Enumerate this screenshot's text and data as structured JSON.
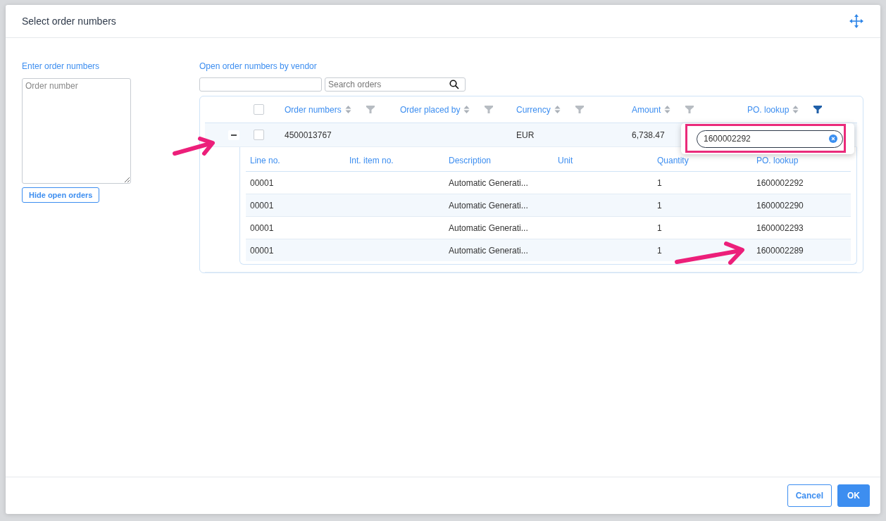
{
  "dialog": {
    "title": "Select order numbers",
    "left": {
      "heading": "Enter order numbers",
      "textarea": {
        "placeholder": "Order number"
      },
      "button": "Hide open orders"
    },
    "right": {
      "heading": "Open order numbers by vendor",
      "search": {
        "placeholder": "Search orders"
      },
      "table": {
        "header_checked": false,
        "columns": [
          {
            "label": "Order numbers",
            "filter_active": false
          },
          {
            "label": "Order placed by",
            "filter_active": false
          },
          {
            "label": "Currency",
            "filter_active": false
          },
          {
            "label": "Amount",
            "filter_active": false
          },
          {
            "label": "PO. lookup",
            "filter_active": true
          }
        ],
        "rows": [
          {
            "expanded": true,
            "checked": false,
            "order_number": "4500013767",
            "currency": "EUR",
            "amount": "6,738.47",
            "items": {
              "columns": [
                "Line no.",
                "Int. item no.",
                "Description",
                "Unit",
                "Quantity",
                "PO. lookup"
              ],
              "rows": [
                {
                  "line_no": "00001",
                  "description": "Automatic Generati...",
                  "quantity": "1",
                  "po_lookup": "1600002292"
                },
                {
                  "line_no": "00001",
                  "description": "Automatic Generati...",
                  "quantity": "1",
                  "po_lookup": "1600002290"
                },
                {
                  "line_no": "00001",
                  "description": "Automatic Generati...",
                  "quantity": "1",
                  "po_lookup": "1600002293"
                },
                {
                  "line_no": "00001",
                  "description": "Automatic Generati...",
                  "quantity": "1",
                  "po_lookup": "1600002289"
                }
              ]
            }
          }
        ]
      }
    },
    "filter_popup": {
      "value": "1600002292"
    },
    "buttons": [
      {
        "label": "Cancel",
        "kind": "secondary"
      },
      {
        "label": "OK",
        "kind": "primary"
      }
    ]
  }
}
